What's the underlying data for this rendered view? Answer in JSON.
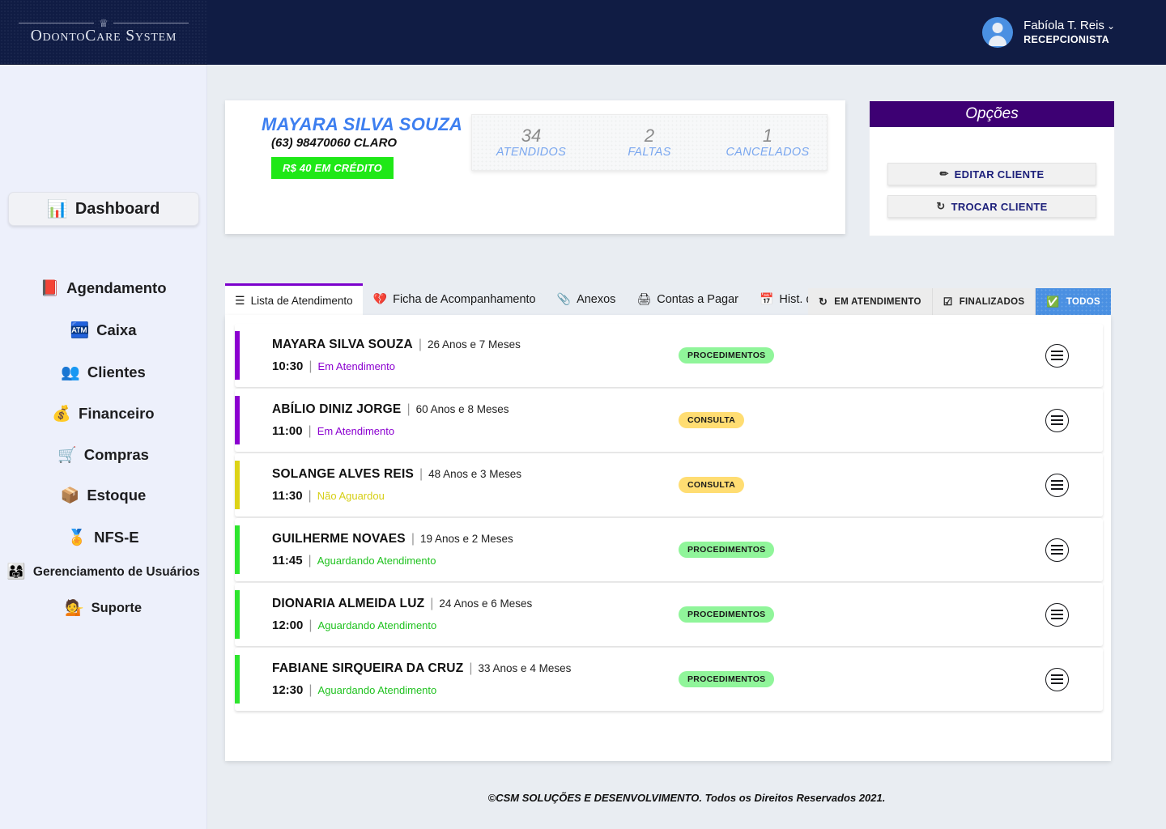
{
  "brand": {
    "name": "OdontoCare System",
    "crown_icon": "crown-icon"
  },
  "topbar": {
    "user_name": "Fabíola T. Reis",
    "chevron": "⌄",
    "user_role": "RECEPCIONISTA"
  },
  "sidebar": {
    "dashboard": {
      "label": "Dashboard",
      "icon": "📊"
    },
    "items": [
      {
        "label": "Agendamento",
        "icon": "📕",
        "name": "agendamento"
      },
      {
        "label": "Caixa",
        "icon": "🏧",
        "name": "caixa"
      },
      {
        "label": "Clientes",
        "icon": "👥",
        "name": "clientes"
      },
      {
        "label": "Financeiro",
        "icon": "💰",
        "name": "financeiro"
      },
      {
        "label": "Compras",
        "icon": "🛒",
        "name": "compras"
      },
      {
        "label": "Estoque",
        "icon": "📦",
        "name": "estoque"
      },
      {
        "label": "NFS-E",
        "icon": "🏅",
        "name": "nfse"
      },
      {
        "label": "Gerenciamento de Usuários",
        "icon": "👨‍👩‍👧",
        "name": "gerenciamento-de-usuarios"
      },
      {
        "label": "Suporte",
        "icon": "💁",
        "name": "suporte"
      }
    ]
  },
  "patient": {
    "name": "MAYARA SILVA SOUZA",
    "phone": "(63) 98470060  CLARO",
    "credit_badge": "R$ 40 EM CRÉDITO",
    "stats": [
      {
        "value": "34",
        "label": "ATENDIDOS"
      },
      {
        "value": "2",
        "label": "FALTAS"
      },
      {
        "value": "1",
        "label": "CANCELADOS"
      }
    ]
  },
  "options": {
    "title": "Opções",
    "edit_label": "EDITAR CLIENTE",
    "edit_icon": "✏",
    "swap_label": "TROCAR CLIENTE",
    "swap_icon": "↻"
  },
  "tabs": [
    {
      "label": "Lista de Atendimento",
      "icon": "☰",
      "active": true
    },
    {
      "label": "Ficha de Acompanhamento",
      "icon": "💔",
      "active": false
    },
    {
      "label": "Anexos",
      "icon": "📎",
      "active": false
    },
    {
      "label": "Contas a Pagar",
      "icon": "🖨",
      "active": false
    },
    {
      "label": "Hist. de Agendamento",
      "icon": "📅",
      "active": false
    }
  ],
  "filters": [
    {
      "label": "EM ATENDIMENTO",
      "icon": "↻",
      "active": false
    },
    {
      "label": "FINALIZADOS",
      "icon": "☑",
      "active": false
    },
    {
      "label": "TODOS",
      "icon": "✅",
      "active": true
    }
  ],
  "appointments": [
    {
      "name": "MAYARA SILVA SOUZA",
      "age": "26 Anos e 7 Meses",
      "time": "10:30",
      "status": "Em Atendimento",
      "status_color": "#8b00d0",
      "bar_color": "#8b00d0",
      "badge": "PROCEDIMENTOS",
      "badge_color": "#90f59a"
    },
    {
      "name": "ABÍLIO DINIZ JORGE",
      "age": "60 Anos e 8 Meses",
      "time": "11:00",
      "status": "Em Atendimento",
      "status_color": "#8b00d0",
      "bar_color": "#8b00d0",
      "badge": "CONSULTA",
      "badge_color": "#ffdd72"
    },
    {
      "name": "SOLANGE ALVES REIS",
      "age": "48 Anos e 3 Meses",
      "time": "11:30",
      "status": "Não Aguardou",
      "status_color": "#d6cf16",
      "bar_color": "#ddd317",
      "badge": "CONSULTA",
      "badge_color": "#ffdd72"
    },
    {
      "name": "GUILHERME NOVAES",
      "age": "19 Anos e 2 Meses",
      "time": "11:45",
      "status": "Aguardando Atendimento",
      "status_color": "#1fc21f",
      "bar_color": "#2ee52e",
      "badge": "PROCEDIMENTOS",
      "badge_color": "#90f59a"
    },
    {
      "name": "DIONARIA ALMEIDA LUZ",
      "age": "24 Anos e 6 Meses",
      "time": "12:00",
      "status": "Aguardando Atendimento",
      "status_color": "#1fc21f",
      "bar_color": "#2ee52e",
      "badge": "PROCEDIMENTOS",
      "badge_color": "#90f59a"
    },
    {
      "name": "FABIANE SIRQUEIRA DA CRUZ",
      "age": "33 Anos e 4 Meses",
      "time": "12:30",
      "status": "Aguardando Atendimento",
      "status_color": "#1fc21f",
      "bar_color": "#2ee52e",
      "badge": "PROCEDIMENTOS",
      "badge_color": "#90f59a"
    }
  ],
  "footer": {
    "text": "©CSM SOLUÇÕES E DESENVOLVIMENTO. Todos os Direitos Reservados 2021."
  },
  "colors": {
    "navy": "#101c44",
    "purple": "#3d0073",
    "accent_blue": "#4a90e2",
    "credit_green": "#1fe817"
  }
}
